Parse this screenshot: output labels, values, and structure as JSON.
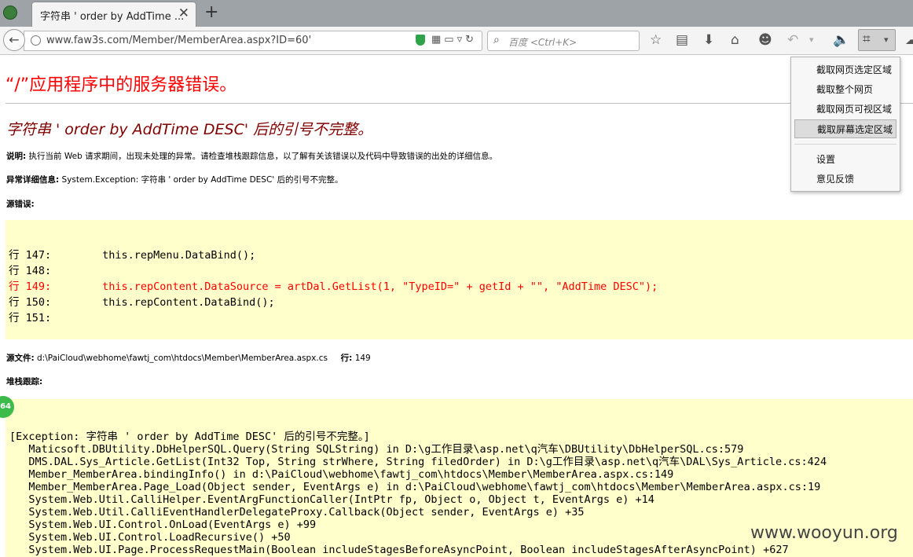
{
  "browser": {
    "tab_title": "字符串 ' order by AddTime ...",
    "tab_close": "✕",
    "new_tab": "+",
    "url": "www.faw3s.com/Member/MemberArea.aspx?ID=60'",
    "search_placeholder": "百度 <Ctrl+K>"
  },
  "menu": {
    "items": [
      "截取网页选定区域",
      "截取整个网页",
      "截取网页可视区域",
      "截取屏幕选定区域"
    ],
    "extra": [
      "设置",
      "意见反馈"
    ],
    "selected_index": 3
  },
  "page": {
    "heading": "“/”应用程序中的服务器错误。",
    "error_title": "字符串 ' order by AddTime DESC' 后的引号不完整。",
    "desc_label": "说明:",
    "desc_text": "执行当前 Web 请求期间，出现未处理的异常。请检查堆栈跟踪信息，以了解有关该错误以及代码中导致错误的出处的详细信息。",
    "exception_label": "异常详细信息:",
    "exception_text": "System.Exception: 字符串 ' order by AddTime DESC' 后的引号不完整。",
    "source_error_label": "源错误:",
    "source_lines": [
      {
        "text": "行 147:        this.repMenu.DataBind();",
        "highlight": false
      },
      {
        "text": "行 148:",
        "highlight": false
      },
      {
        "text": "行 149:        this.repContent.DataSource = artDal.GetList(1, \"TypeID=\" + getId + \"\", \"AddTime DESC\");",
        "highlight": true
      },
      {
        "text": "行 150:        this.repContent.DataBind();",
        "highlight": false
      },
      {
        "text": "行 151:",
        "highlight": false
      }
    ],
    "source_file_label": "源文件:",
    "source_file": "d:\\PaiCloud\\webhome\\fawtj_com\\htdocs\\Member\\MemberArea.aspx.cs",
    "line_label": "行:",
    "line_number": "149",
    "stack_label": "堆栈跟踪:",
    "stack_exception": "[Exception: 字符串 ' order by AddTime DESC' 后的引号不完整。]",
    "stack_lines": [
      "   Maticsoft.DBUtility.DbHelperSQL.Query(String SQLString) in D:\\g工作目录\\asp.net\\q汽车\\DBUtility\\DbHelperSQL.cs:579",
      "   DMS.DAL.Sys_Article.GetList(Int32 Top, String strWhere, String filedOrder) in D:\\g工作目录\\asp.net\\q汽车\\DAL\\Sys_Article.cs:424",
      "   Member_MemberArea.bindingInfo() in d:\\PaiCloud\\webhome\\fawtj_com\\htdocs\\Member\\MemberArea.aspx.cs:149",
      "   Member_MemberArea.Page_Load(Object sender, EventArgs e) in d:\\PaiCloud\\webhome\\fawtj_com\\htdocs\\Member\\MemberArea.aspx.cs:19",
      "   System.Web.Util.CalliHelper.EventArgFunctionCaller(IntPtr fp, Object o, Object t, EventArgs e) +14",
      "   System.Web.Util.CalliEventHandlerDelegateProxy.Callback(Object sender, EventArgs e) +35",
      "   System.Web.UI.Control.OnLoad(EventArgs e) +99",
      "   System.Web.UI.Control.LoadRecursive() +50",
      "   System.Web.UI.Page.ProcessRequestMain(Boolean includeStagesBeforeAsyncPoint, Boolean includeStagesAfterAsyncPoint) +627"
    ]
  },
  "badge": "64",
  "watermark": "www.wooyun.org",
  "colors": {
    "heading": "#ff0000",
    "error_title": "#800000",
    "code_bg": "#ffffcc"
  }
}
